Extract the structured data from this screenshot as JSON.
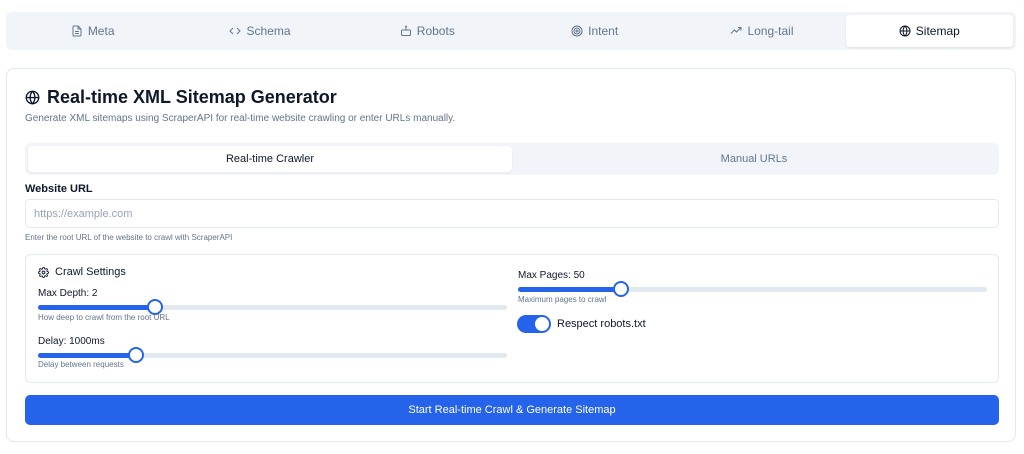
{
  "tabs": [
    {
      "label": "Meta",
      "icon": "document-icon",
      "active": false
    },
    {
      "label": "Schema",
      "icon": "code-icon",
      "active": false
    },
    {
      "label": "Robots",
      "icon": "bot-icon",
      "active": false
    },
    {
      "label": "Intent",
      "icon": "target-icon",
      "active": false
    },
    {
      "label": "Long-tail",
      "icon": "trending-icon",
      "active": false
    },
    {
      "label": "Sitemap",
      "icon": "globe-icon",
      "active": true
    }
  ],
  "header": {
    "title": "Real-time XML Sitemap Generator",
    "subtitle": "Generate XML sitemaps using ScraperAPI for real-time website crawling or enter URLs manually."
  },
  "modes": [
    {
      "label": "Real-time Crawler",
      "active": true
    },
    {
      "label": "Manual URLs",
      "active": false
    }
  ],
  "url_field": {
    "label": "Website URL",
    "placeholder": "https://example.com",
    "value": "",
    "hint": "Enter the root URL of the website to crawl with ScraperAPI"
  },
  "crawl_settings": {
    "title": "Crawl Settings",
    "max_depth": {
      "label": "Max Depth: 2",
      "help": "How deep to crawl from the root URL",
      "fraction": 0.25
    },
    "delay": {
      "label": "Delay: 1000ms",
      "help": "Delay between requests",
      "fraction": 0.21
    },
    "max_pages": {
      "label": "Max Pages: 50",
      "help": "Maximum pages to crawl",
      "fraction": 0.22
    },
    "respect_robots": {
      "label": "Respect robots.txt",
      "enabled": true
    }
  },
  "actions": {
    "start_label": "Start Real-time Crawl & Generate Sitemap"
  },
  "colors": {
    "accent": "#2563eb",
    "muted": "#64748b",
    "border": "#e2e8f0"
  }
}
